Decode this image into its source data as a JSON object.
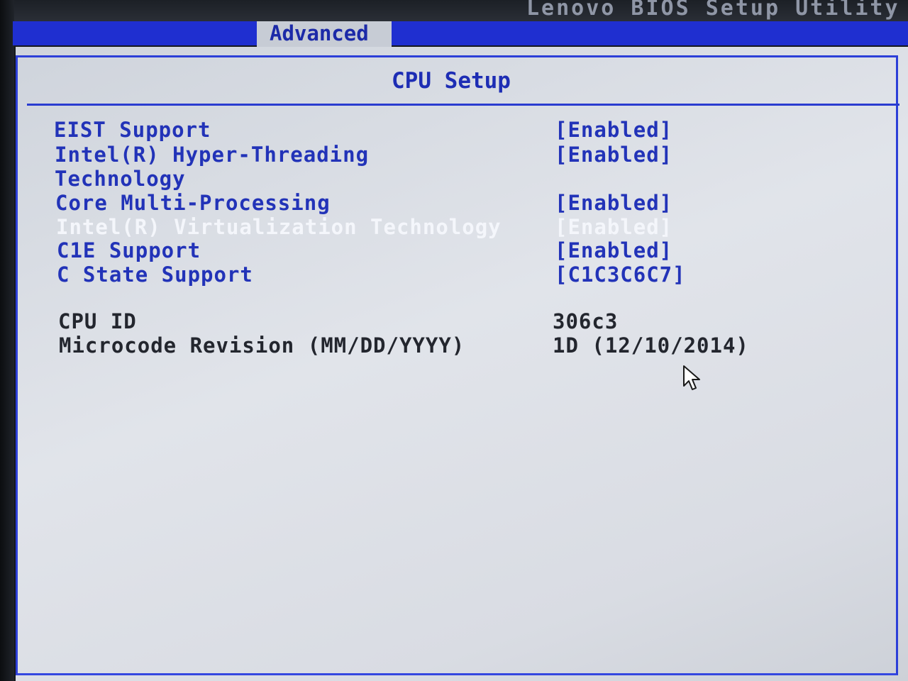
{
  "header": {
    "app_title": "Lenovo BIOS Setup Utility",
    "active_tab": "Advanced"
  },
  "page": {
    "title": "CPU Setup"
  },
  "settings": [
    {
      "label": "EIST Support",
      "value": "[Enabled]"
    },
    {
      "label": "Intel(R) Hyper-Threading",
      "value": "[Enabled]"
    },
    {
      "label": "Technology"
    },
    {
      "label": "Core Multi-Processing",
      "value": "[Enabled]"
    },
    {
      "label": "Intel(R) Virtualization Technology",
      "value": "[Enabled]"
    },
    {
      "label": "C1E Support",
      "value": "[Enabled]"
    },
    {
      "label": "C State Support",
      "value": "[C1C3C6C7]"
    }
  ],
  "info": [
    {
      "label": "CPU ID",
      "value": "306c3"
    },
    {
      "label": "Microcode Revision (MM/DD/YYYY)",
      "value": "1D (12/10/2014)"
    }
  ],
  "colors": {
    "menu_bar": "#1f2fd0",
    "panel_background": "#dde0e6",
    "setting_text": "#2233b8",
    "selected_text": "#f4f6fb",
    "info_text": "#23262e"
  }
}
